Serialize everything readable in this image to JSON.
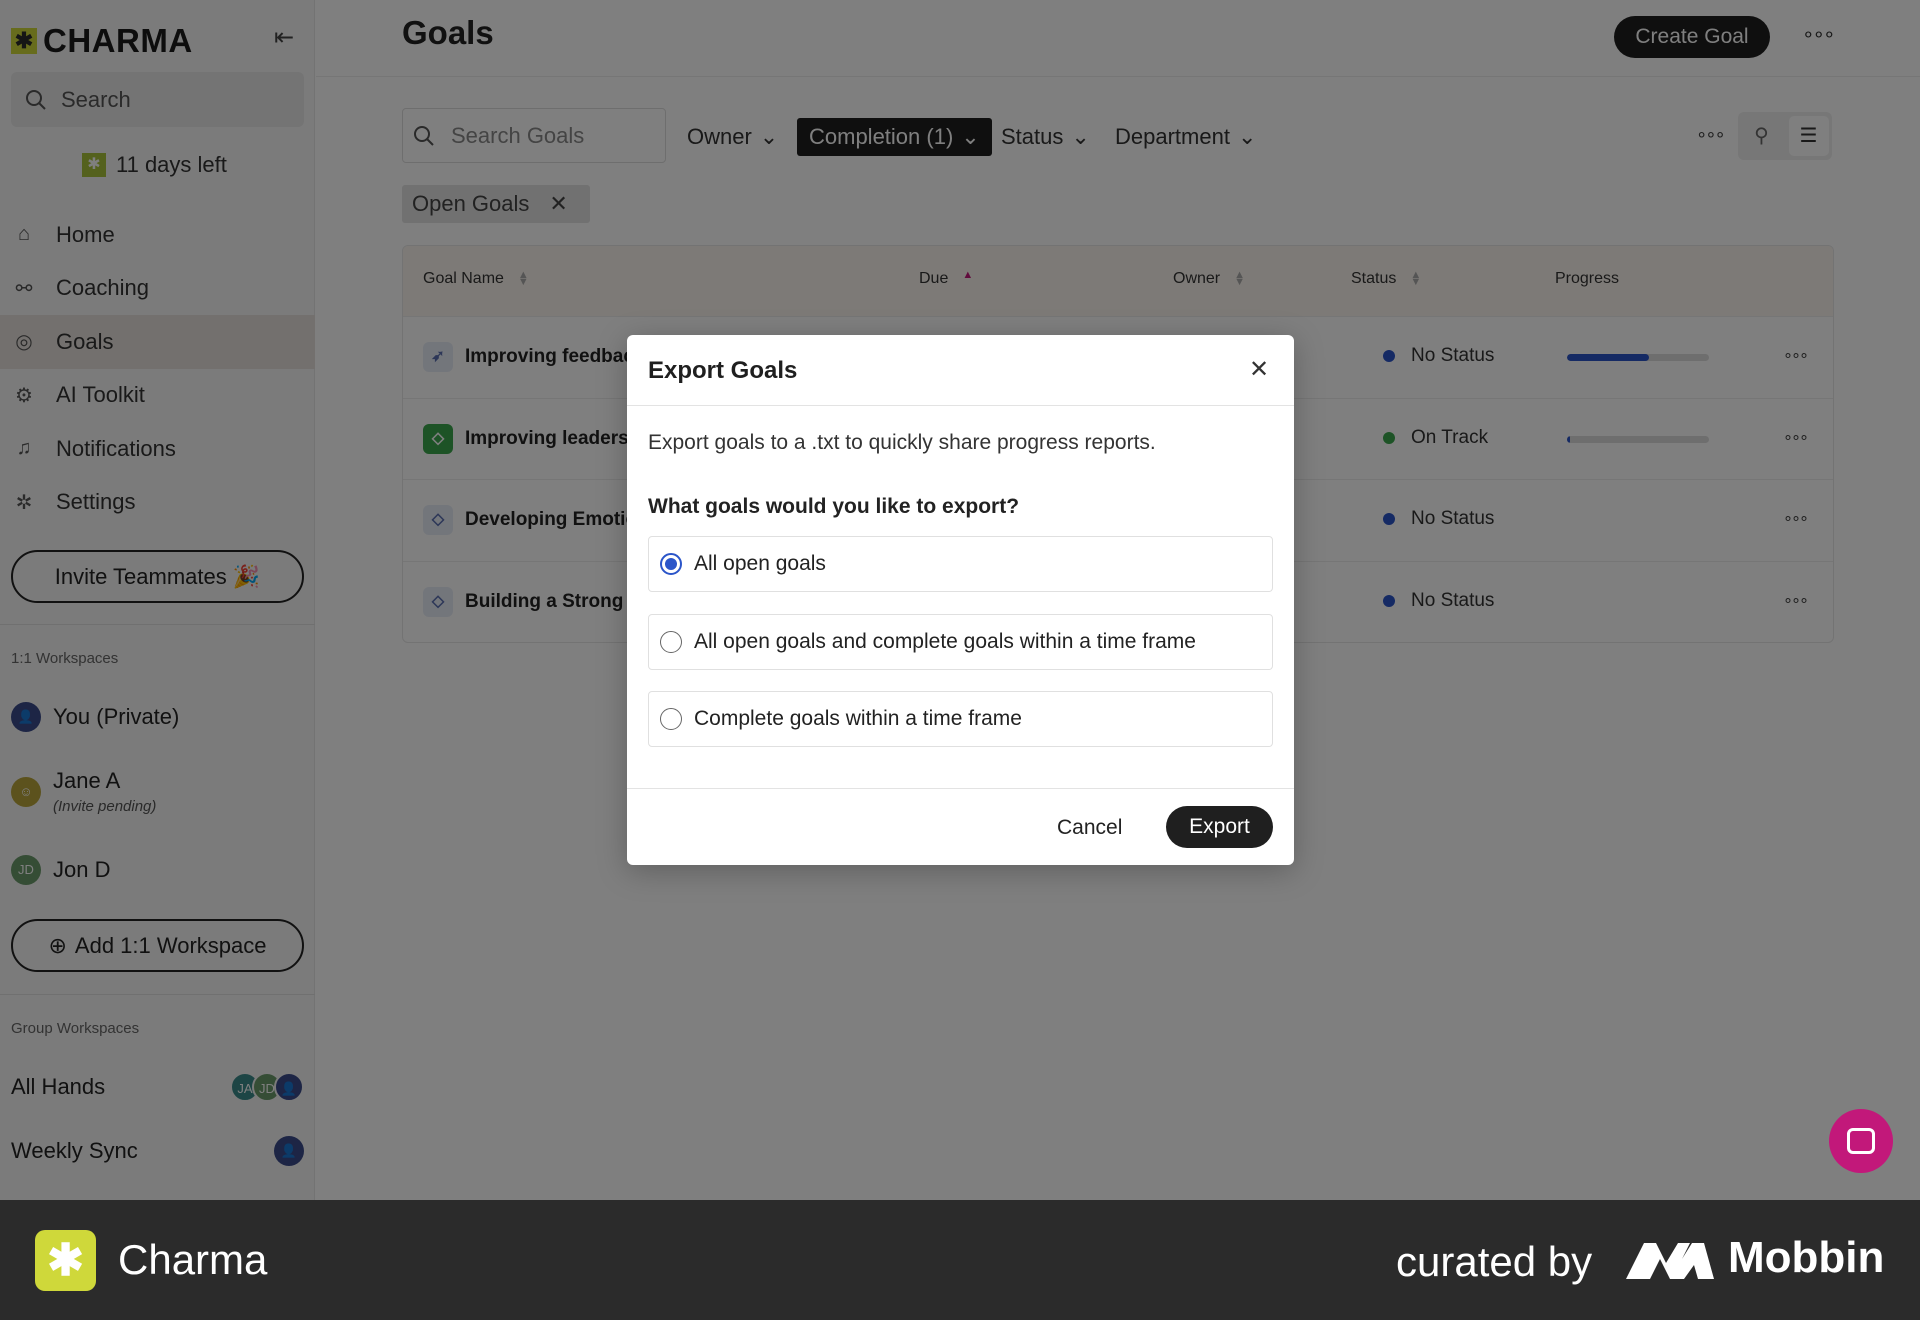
{
  "sidebar": {
    "brand": "CHARMA",
    "search_placeholder": "Search",
    "trial": "11 days left",
    "nav": [
      {
        "label": "Home",
        "icon": "home-icon"
      },
      {
        "label": "Coaching",
        "icon": "coaching-icon"
      },
      {
        "label": "Goals",
        "icon": "target-icon"
      },
      {
        "label": "AI Toolkit",
        "icon": "robot-icon"
      },
      {
        "label": "Notifications",
        "icon": "bell-icon"
      },
      {
        "label": "Settings",
        "icon": "gear-icon"
      }
    ],
    "invite_label": "Invite Teammates 🎉",
    "one_on_one_label": "1:1 Workspaces",
    "workspaces": [
      {
        "name": "You (Private)"
      },
      {
        "name": "Jane A",
        "sub": "(Invite pending)"
      },
      {
        "name": "Jon D",
        "initials": "JD"
      }
    ],
    "add_workspace_label": "Add 1:1 Workspace",
    "group_label": "Group Workspaces",
    "groups": [
      {
        "name": "All Hands",
        "avatars": [
          "JA",
          "JD"
        ]
      },
      {
        "name": "Weekly Sync"
      }
    ]
  },
  "main": {
    "title": "Goals",
    "create_label": "Create Goal",
    "search_placeholder": "Search Goals",
    "filters": [
      "Owner",
      "Completion (1)",
      "Status",
      "Department"
    ],
    "chip": "Open Goals",
    "columns": [
      "Goal Name",
      "Due",
      "Owner",
      "Status",
      "Progress"
    ],
    "rows": [
      {
        "name": "Improving feedbac",
        "status": "No Status",
        "status_color": "#2b55c9",
        "progress": 0.58,
        "icon_bg": "#e7ecf7",
        "icon_color": "#5a6fb0"
      },
      {
        "name": "Improving leadersh",
        "status": "On Track",
        "status_color": "#3aa64c",
        "progress": 0.02,
        "icon_bg": "#3aa64c",
        "icon_color": "#ffffff"
      },
      {
        "name": "Developing Emotio",
        "status": "No Status",
        "status_color": "#2b55c9",
        "progress": null,
        "icon_bg": "#e7ecf7",
        "icon_color": "#5a6fb0"
      },
      {
        "name": "Building a Strong N",
        "status": "No Status",
        "status_color": "#2b55c9",
        "progress": null,
        "icon_bg": "#e7ecf7",
        "icon_color": "#5a6fb0"
      }
    ]
  },
  "modal": {
    "title": "Export Goals",
    "description": "Export goals to a .txt to quickly share progress reports.",
    "question": "What goals would you like to export?",
    "options": [
      {
        "label": "All open goals",
        "checked": true
      },
      {
        "label": "All open goals and complete goals within a time frame",
        "checked": false
      },
      {
        "label": "Complete goals within a time frame",
        "checked": false
      }
    ],
    "cancel_label": "Cancel",
    "export_label": "Export"
  },
  "banner": {
    "app_name": "Charma",
    "curated_by": "curated by",
    "brand": "Mobbin"
  }
}
